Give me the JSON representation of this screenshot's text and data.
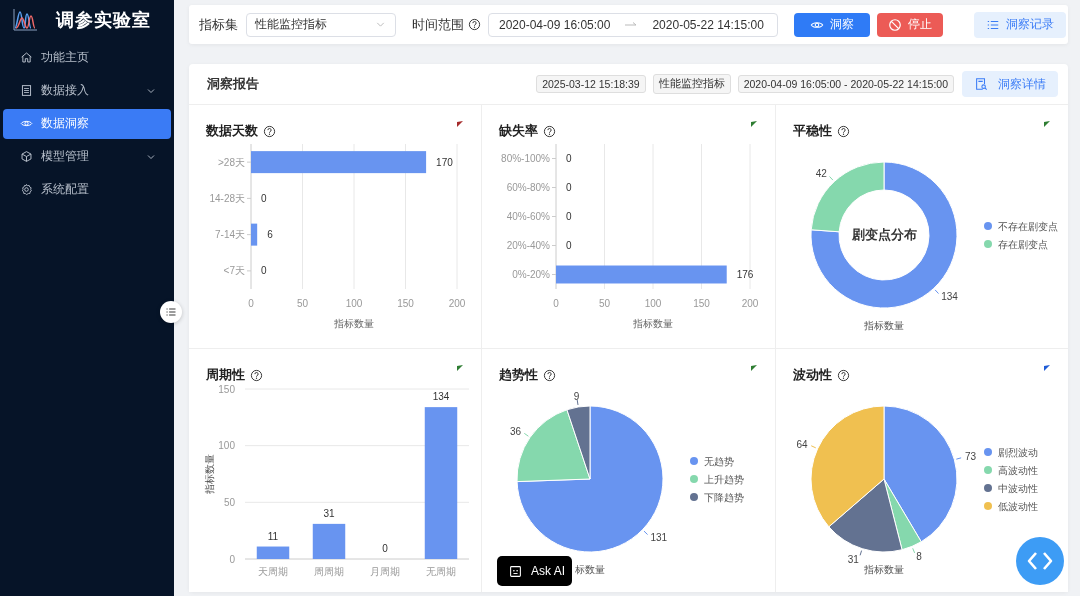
{
  "sidebar": {
    "app_title": "调参实验室",
    "items": [
      {
        "label": "功能主页",
        "kind": "home",
        "selected": false
      },
      {
        "label": "数据接入",
        "kind": "data",
        "selected": false,
        "expanded": false
      },
      {
        "label": "数据洞察",
        "kind": "eye",
        "selected": true
      },
      {
        "label": "模型管理",
        "kind": "cube",
        "selected": false,
        "expanded": false
      },
      {
        "label": "系统配置",
        "kind": "gear",
        "selected": false
      }
    ]
  },
  "toolbar": {
    "metric_set_label": "指标集",
    "metric_set": "性能监控指标",
    "time_range_label": "时间范围",
    "start": "2020-04-09 16:05:00",
    "end": "2020-05-22 14:15:00",
    "buttons": [
      {
        "label": "洞察",
        "kind": "primary"
      },
      {
        "label": "停止",
        "kind": "danger"
      },
      {
        "label": "洞察记录",
        "kind": "light"
      }
    ]
  },
  "report": {
    "title": "洞察报告",
    "tags": [
      "2025-03-12 15:18:39",
      "性能监控指标",
      "2020-04-09 16:05:00 - 2020-05-22 14:15:00"
    ],
    "detail_button": "洞察详情",
    "panels": [
      {
        "color": "#a52a2a",
        "chart_data": {
          "type": "bar",
          "orientation": "horizontal",
          "title": "数据天数",
          "xlabel": "指标数量",
          "categories": [
            ">28天",
            "14-28天",
            "7-14天",
            "<7天"
          ],
          "values": [
            170,
            0,
            6,
            0
          ],
          "xlim": [
            0,
            200
          ],
          "xticks": [
            0,
            50,
            100,
            150,
            200
          ],
          "grid": true,
          "data_labels": true
        }
      },
      {
        "color": "#2e7d32",
        "chart_data": {
          "type": "bar",
          "orientation": "horizontal",
          "title": "缺失率",
          "xlabel": "指标数量",
          "categories": [
            "80%-100%",
            "60%-80%",
            "40%-60%",
            "20%-40%",
            "0%-20%"
          ],
          "values": [
            0,
            0,
            0,
            0,
            176
          ],
          "xlim": [
            0,
            200
          ],
          "xticks": [
            0,
            50,
            100,
            150,
            200
          ],
          "grid": true,
          "data_labels": true
        }
      },
      {
        "color": "#2e7d32",
        "chart_data": {
          "type": "donut",
          "title": "平稳性",
          "xlabel": "指标数量",
          "annotations": [
            "剧变点分布"
          ],
          "categories": [
            "不存在剧变点",
            "存在剧变点"
          ],
          "values": [
            134,
            42
          ],
          "colors": [
            "#6894f0",
            "#85d8ad"
          ],
          "legend": "right",
          "data_labels": true
        }
      },
      {
        "color": "#2e7d32",
        "chart_data": {
          "type": "bar",
          "orientation": "vertical",
          "title": "周期性",
          "ylabel": "指标数量",
          "categories": [
            "天周期",
            "周周期",
            "月周期",
            "无周期"
          ],
          "values": [
            11,
            31,
            0,
            134
          ],
          "ylim": [
            0,
            150
          ],
          "yticks": [
            0,
            50,
            100,
            150
          ],
          "grid": true,
          "data_labels": true
        }
      },
      {
        "color": "#2e7d32",
        "chart_data": {
          "type": "pie",
          "title": "趋势性",
          "xlabel": "标数量",
          "categories": [
            "无趋势",
            "上升趋势",
            "下降趋势"
          ],
          "values": [
            131,
            36,
            9
          ],
          "colors": [
            "#6894f0",
            "#85d8ad",
            "#637291"
          ],
          "legend": "right",
          "data_labels": true
        }
      },
      {
        "color": "#1e5bd6",
        "chart_data": {
          "type": "pie",
          "title": "波动性",
          "xlabel": "指标数量",
          "categories": [
            "剧烈波动",
            "高波动性",
            "中波动性",
            "低波动性"
          ],
          "values": [
            73,
            8,
            31,
            64
          ],
          "colors": [
            "#6894f0",
            "#85d8ad",
            "#637291",
            "#f0c050"
          ],
          "legend": "right",
          "data_labels": true
        }
      }
    ]
  },
  "ask_ai": "Ask AI"
}
